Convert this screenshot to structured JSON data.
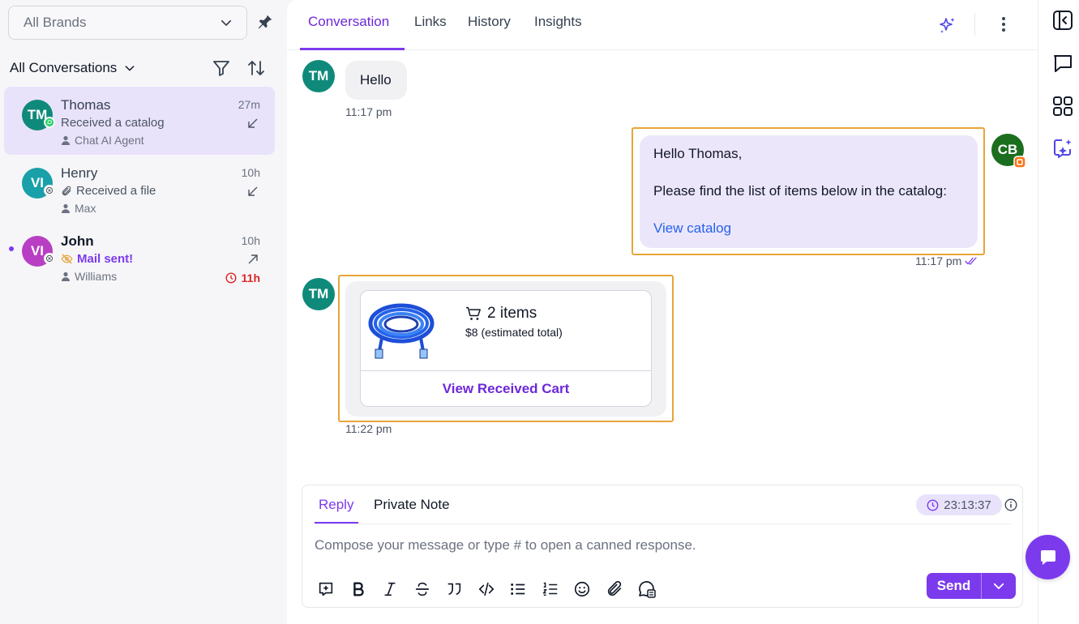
{
  "sidebar": {
    "brand_select": {
      "value": "All Brands"
    },
    "filter_title": "All Conversations",
    "conversations": [
      {
        "initials": "TM",
        "name": "Thomas",
        "time": "27m",
        "message": "Received a catalog",
        "agent": "Chat AI Agent",
        "avatar_color": "#0f8a7a",
        "channel_icon": "whatsapp-icon"
      },
      {
        "initials": "VI",
        "name": "Henry",
        "time": "10h",
        "message": "Received a file",
        "agent": "Max",
        "avatar_color": "#1aa0a8",
        "channel_icon": "closed-channel-icon"
      },
      {
        "initials": "VI",
        "name": "John",
        "time": "10h",
        "message": "Mail sent!",
        "agent": "Williams",
        "late_time": "11h",
        "avatar_color": "#b83fc4",
        "channel_icon": "closed-channel-icon"
      }
    ]
  },
  "header": {
    "tabs": [
      "Conversation",
      "Links",
      "History",
      "Insights"
    ]
  },
  "messages": {
    "m1": {
      "initials": "TM",
      "text": "Hello",
      "time": "11:17 pm"
    },
    "m2": {
      "initials": "CB",
      "greeting": "Hello Thomas,",
      "body": "Please find the list of items below in the catalog:",
      "link": "View catalog",
      "time": "11:17 pm"
    },
    "m3": {
      "initials": "TM",
      "items": "2 items",
      "total": "$8 (estimated total)",
      "action": "View Received Cart",
      "time": "11:22 pm"
    }
  },
  "composer": {
    "tabs": [
      "Reply",
      "Private Note"
    ],
    "timer": "23:13:37",
    "placeholder": "Compose your message or type # to open a canned response.",
    "send_label": "Send"
  },
  "colors": {
    "accent": "#7c3aed",
    "highlight": "#e7a43a",
    "link": "#2563eb"
  }
}
